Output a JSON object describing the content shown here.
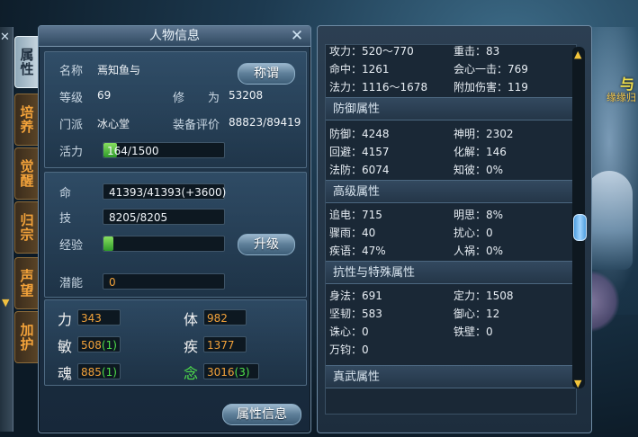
{
  "scene": {
    "name": "与",
    "title": "缘缘归"
  },
  "tabs": [
    "属性",
    "培养",
    "觉醒",
    "归宗",
    "声望",
    "加护"
  ],
  "panel": {
    "title": "人物信息",
    "name_label": "名称",
    "name_value": "焉知鱼与",
    "title_button": "称谓",
    "level_label": "等级",
    "level_value": "69",
    "cultivation_label": "修　　为",
    "cultivation_value": "53208",
    "sect_label": "门派",
    "sect_value": "冰心堂",
    "gear_label": "装备评价",
    "gear_value": "88823/89419",
    "vitality_label": "活力",
    "vitality_value": "164/1500",
    "vitality_fraction": 0.109,
    "hp_label": "命",
    "hp_value": "41393/41393(+3600)",
    "skill_label": "技",
    "skill_value": "8205/8205",
    "exp_label": "经验",
    "exp_fraction": 0.08,
    "upgrade_button": "升级",
    "potential_label": "潜能",
    "potential_value": "0",
    "stats": [
      {
        "label": "力",
        "value": "343",
        "bonus": ""
      },
      {
        "label": "体",
        "value": "982",
        "bonus": ""
      },
      {
        "label": "敏",
        "value": "508",
        "bonus": "(1)"
      },
      {
        "label": "疾",
        "value": "1377",
        "bonus": ""
      },
      {
        "label": "魂",
        "value": "885",
        "bonus": "(1)"
      },
      {
        "label": "念",
        "value": "3016",
        "bonus": "(3)"
      }
    ],
    "attr_button": "属性信息"
  },
  "right": {
    "top_rows": [
      [
        "攻力：520～770",
        "重击：83"
      ],
      [
        "命中：1261",
        "会心一击：769"
      ],
      [
        "法力：1116～1678",
        "附加伤害：119"
      ]
    ],
    "sections": [
      {
        "title": "防御属性",
        "rows": [
          [
            "防御：4248",
            "神明：2302"
          ],
          [
            "回避：4157",
            "化解：146"
          ],
          [
            "法防：6074",
            "知彼：0%"
          ]
        ]
      },
      {
        "title": "高级属性",
        "rows": [
          [
            "追电：715",
            "明思：8%"
          ],
          [
            "骤雨：40",
            "扰心：0"
          ],
          [
            "疾语：47%",
            "人祸：0%"
          ]
        ]
      },
      {
        "title": "抗性与特殊属性",
        "rows": [
          [
            "身法：691",
            "定力：1508"
          ],
          [
            "坚韧：583",
            "御心：12"
          ],
          [
            "诛心：0",
            "铁壁：0"
          ],
          [
            "万钧：0",
            ""
          ]
        ]
      },
      {
        "title": "真武属性",
        "rows": []
      }
    ]
  }
}
